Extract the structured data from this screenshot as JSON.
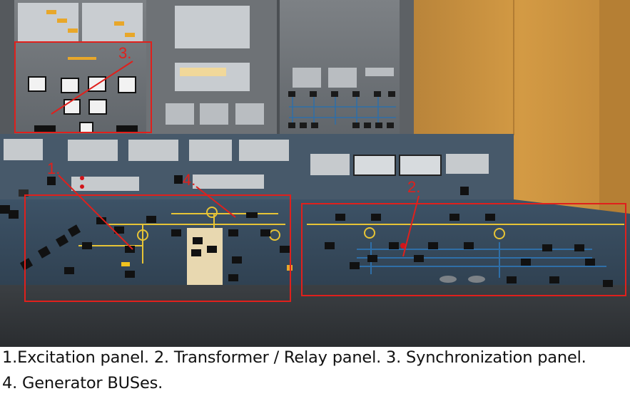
{
  "annotations": [
    {
      "number": "1.",
      "panel": "Excitation panel"
    },
    {
      "number": "2.",
      "panel": "Transformer / Relay panel"
    },
    {
      "number": "3.",
      "panel": "Synchronization panel"
    },
    {
      "number": "4.",
      "panel": "Generator BUSes"
    }
  ],
  "caption": {
    "line1": "1.Excitation panel. 2. Transformer / Relay panel. 3. Synchronization panel.",
    "line2": "4. Generator BUSes."
  },
  "colors": {
    "annotation": "#e0201c",
    "console": "#3a4d5f",
    "wall_panel": "#6f7377",
    "wood": "#c8923d",
    "mimic_yellow": "#e7c436",
    "mimic_blue": "#2f6fa8"
  }
}
